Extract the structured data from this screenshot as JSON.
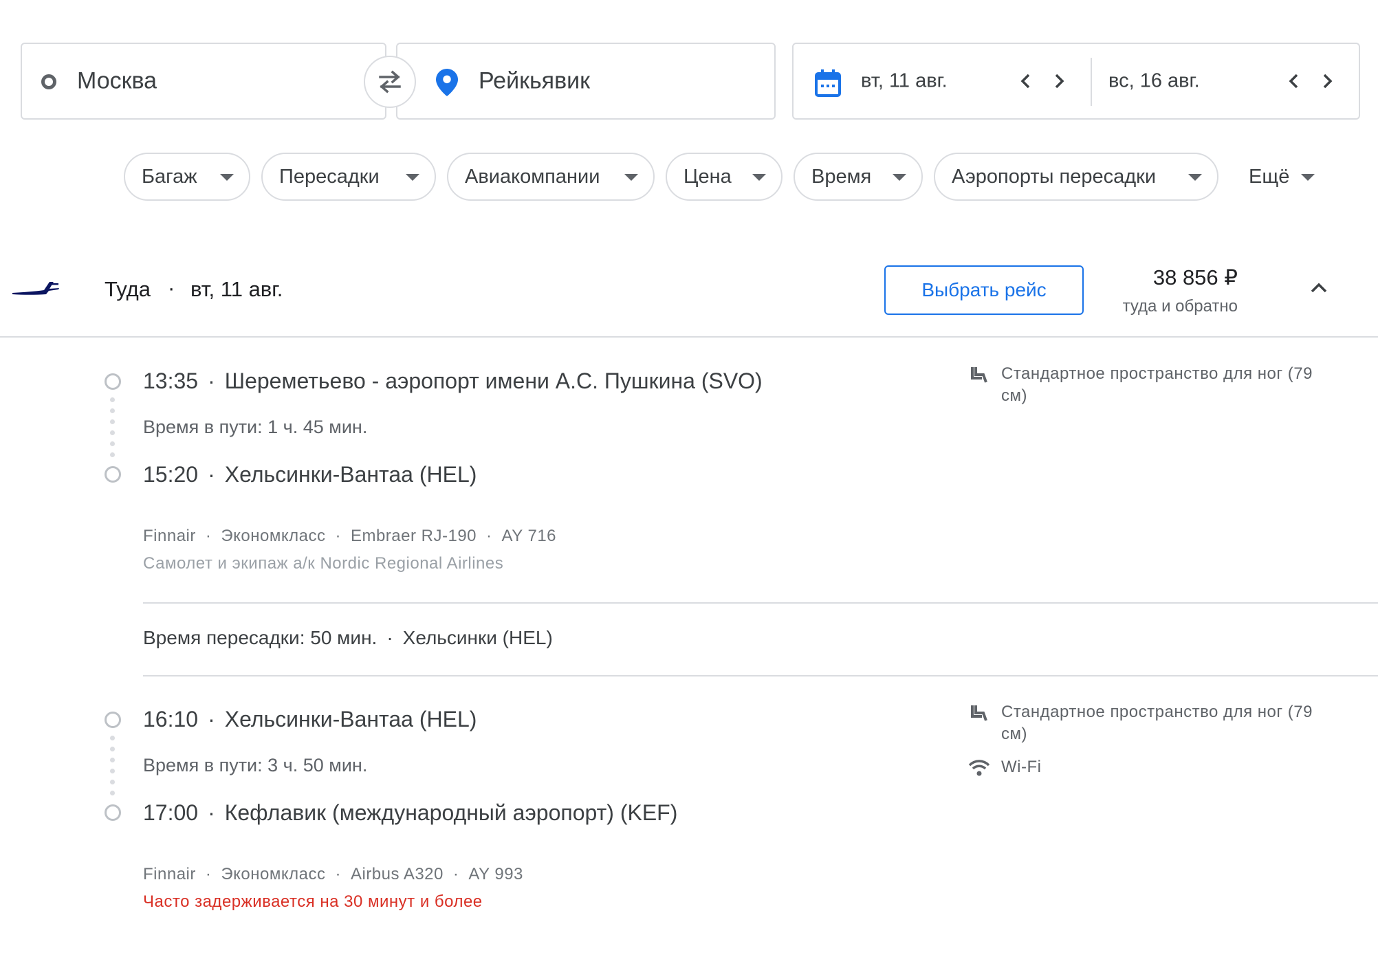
{
  "search": {
    "origin": "Москва",
    "destination": "Рейкьявик",
    "depart_date": "вт, 11 авг.",
    "return_date": "вс, 16 авг."
  },
  "filters": [
    "Багаж",
    "Пересадки",
    "Авиакомпании",
    "Цена",
    "Время",
    "Аэропорты пересадки",
    "Ещё"
  ],
  "flight": {
    "direction": "Туда",
    "date": "вт, 11 авг.",
    "select_label": "Выбрать рейс",
    "price": "38 856 ₽",
    "price_note": "туда и обратно",
    "segments": [
      {
        "depart_time": "13:35",
        "depart_airport": "Шереметьево - аэропорт имени А.С. Пушкина (SVO)",
        "duration": "Время в пути: 1 ч. 45 мин.",
        "arrive_time": "15:20",
        "arrive_airport": "Хельсинки-Вантаа (HEL)",
        "airline": "Finnair",
        "cabin": "Экономкласс",
        "aircraft": "Embraer RJ-190",
        "flight_no": "AY 716",
        "operator_note": "Самолет и экипаж а/к Nordic Regional Airlines",
        "amenities": [
          {
            "icon": "seat-icon",
            "text": "Стандартное пространство для ног (79 см)"
          }
        ]
      },
      {
        "depart_time": "16:10",
        "depart_airport": "Хельсинки-Вантаа (HEL)",
        "duration": "Время в пути: 3 ч. 50 мин.",
        "arrive_time": "17:00",
        "arrive_airport": "Кефлавик (международный аэропорт) (KEF)",
        "airline": "Finnair",
        "cabin": "Экономкласс",
        "aircraft": "Airbus A320",
        "flight_no": "AY 993",
        "delay_warning": "Часто задерживается на 30 минут и более",
        "amenities": [
          {
            "icon": "seat-icon",
            "text": "Стандартное пространство для ног (79 см)"
          },
          {
            "icon": "wifi-icon",
            "text": "Wi-Fi"
          }
        ]
      }
    ],
    "layover": {
      "duration": "Время пересадки: 50 мин.",
      "airport": "Хельсинки (HEL)"
    }
  },
  "colors": {
    "accent": "#1a73e8",
    "border": "#dadce0",
    "warning": "#d93025",
    "finnair_logo": "#0b1560"
  }
}
